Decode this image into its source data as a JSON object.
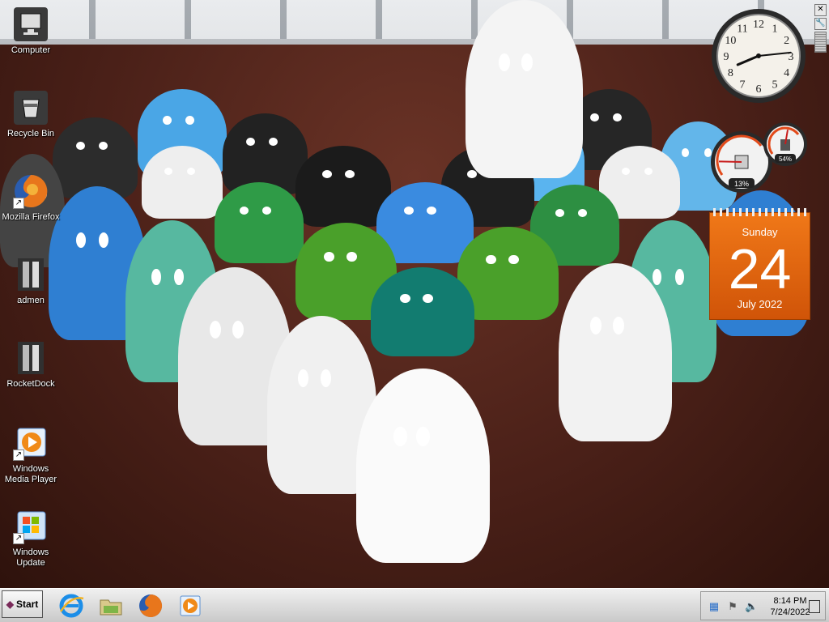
{
  "desktop": {
    "icons": [
      {
        "label": "Computer",
        "icon": "computer-icon"
      },
      {
        "label": "Recycle Bin",
        "icon": "recycle-bin-icon"
      },
      {
        "label": "Mozilla Firefox",
        "icon": "firefox-icon"
      },
      {
        "label": "admen",
        "icon": "dock-icon"
      },
      {
        "label": "RocketDock",
        "icon": "dock-icon"
      },
      {
        "label": "Windows Media Player",
        "icon": "media-player-icon"
      },
      {
        "label": "Windows Update",
        "icon": "windows-update-icon"
      }
    ]
  },
  "gadgets": {
    "clock": {
      "hour": 8,
      "minute": 14,
      "numerals": [
        "12",
        "1",
        "2",
        "3",
        "4",
        "5",
        "6",
        "7",
        "8",
        "9",
        "10",
        "11"
      ]
    },
    "meter": {
      "cpu_label": "13%",
      "memory_label": "54%",
      "cpu": 0.13,
      "memory": 0.54
    },
    "calendar": {
      "day_name": "Sunday",
      "day_number": "24",
      "month_year": "July 2022"
    },
    "tools": {
      "close": "✕",
      "options": "🔧"
    }
  },
  "taskbar": {
    "start_label": "Start",
    "pinned": [
      "internet-explorer-icon",
      "file-explorer-icon",
      "firefox-icon",
      "media-player-icon"
    ],
    "clock_time": "8:14 PM",
    "clock_date": "7/24/2022",
    "tray_icons": [
      "network-icon",
      "action-center-icon",
      "volume-muted-icon"
    ]
  },
  "colors": {
    "calendar_orange": "#e8660f",
    "desktop_wood": "#5a2a1f"
  }
}
